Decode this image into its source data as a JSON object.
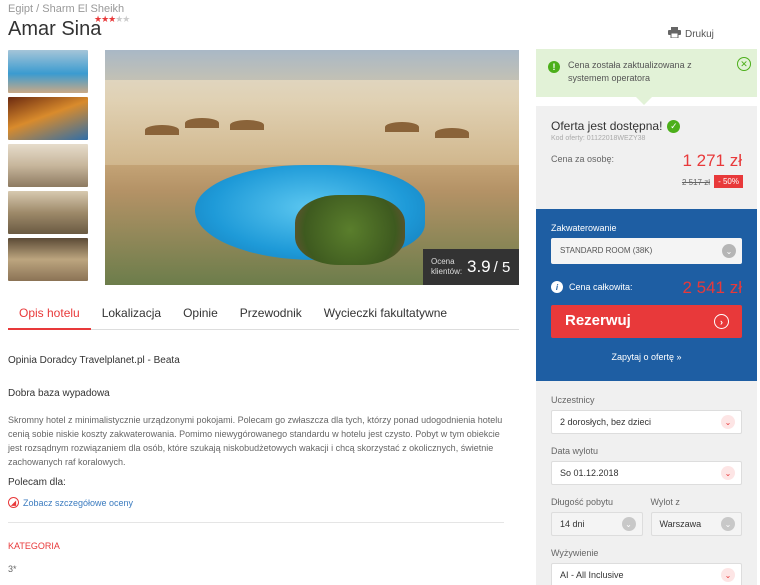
{
  "breadcrumb": "Egipt /  Sharm El Sheikh",
  "hotel": {
    "name": "Amar Sina",
    "stars": 3,
    "stars_max": 5
  },
  "print_label": "Drukuj",
  "rating": {
    "label": "Ocena klientów:",
    "value": "3.9",
    "scale": "/ 5"
  },
  "tabs": [
    "Opis hotelu",
    "Lokalizacja",
    "Opinie",
    "Przewodnik",
    "Wycieczki fakultatywne"
  ],
  "content": {
    "opinion_title": "Opinia Doradcy Travelplanet.pl - Beata",
    "subtitle": "Dobra baza wypadowa",
    "text": "Skromny hotel z minimalistycznie urządzonymi pokojami. Polecam go zwłaszcza dla tych, którzy ponad udogodnienia hotelu cenią sobie niskie koszty zakwaterowania. Pomimo niewygórowanego standardu w hotelu jest czysto. Pobyt w tym obiekcie jest rozsądnym rozwiązaniem dla osób, które szukają niskobudżetowych wakacji i chcą skorzystać z okolicznych, świetnie zachowanych raf koralowych.",
    "recommend": "Polecam dla:",
    "link": "Zobacz szczegółowe oceny",
    "category_label": "KATEGORIA",
    "category_value": "3*"
  },
  "notice": "Cena została zaktualizowana z systemem operatora",
  "offer": {
    "title": "Oferta jest dostępna!",
    "code": "Kod oferty: 01122018WEZY38",
    "per_person_label": "Cena za osobę:",
    "price": "1 271 zł",
    "old_price": "2 517 zł",
    "discount": "- 50%"
  },
  "booking": {
    "accommodation_label": "Zakwaterowanie",
    "room": "STANDARD ROOM (38K)",
    "total_label": "Cena całkowita:",
    "total": "2 541 zł",
    "book_button": "Rezerwuj",
    "ask": "Zapytaj o ofertę »"
  },
  "filters": {
    "participants_label": "Uczestnicy",
    "participants": "2 dorosłych, bez dzieci",
    "date_label": "Data wylotu",
    "date": "So 01.12.2018",
    "length_label": "Długość pobytu",
    "length": "14 dni",
    "from_label": "Wylot z",
    "from": "Warszawa",
    "board_label": "Wyżywienie",
    "board": "AI - All Inclusive"
  },
  "colors": {
    "accent": "#e8393a",
    "brand_blue": "#1e5ea3",
    "success": "#4caf1a"
  }
}
